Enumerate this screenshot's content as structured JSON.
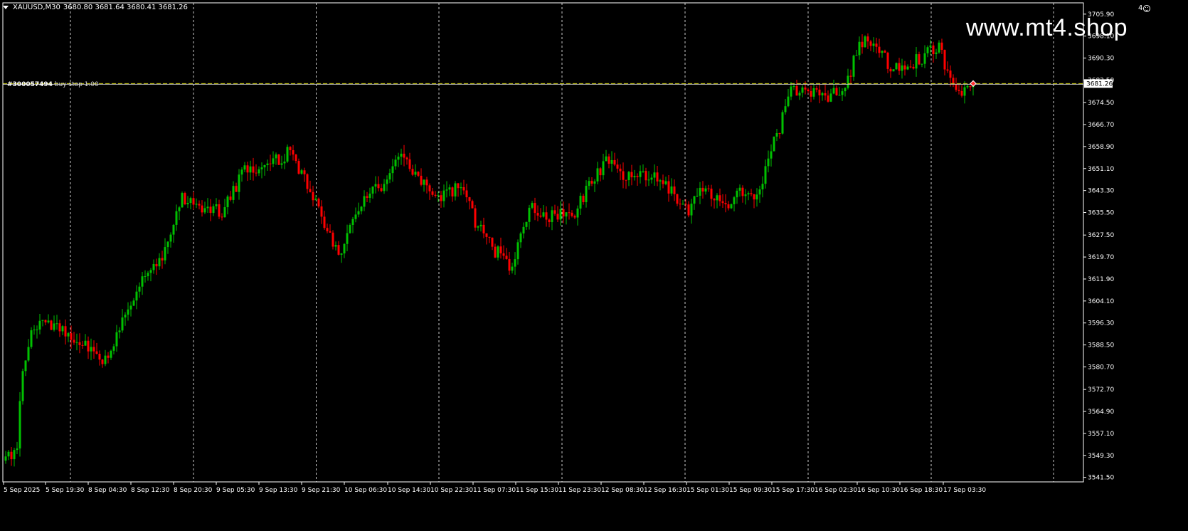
{
  "window": {
    "symbol": "XAUUSD,M30",
    "ohlc": "3680.80 3681.64 3680.41 3681.26",
    "watermark": "www.mt4.shop",
    "expert_count": "4",
    "expert_icon": "smiley-icon"
  },
  "order_line": {
    "id": "#300057494",
    "label": "buy stop 1.00"
  },
  "colors": {
    "background": "#000000",
    "bull": "#00c000",
    "bear": "#ff0000",
    "grid": "#c8c8c8",
    "order_line": "#c8c800",
    "bid_line": "#c8c8c8",
    "text": "#ffffff"
  },
  "chart_data": {
    "type": "candlestick",
    "symbol": "XAUUSD",
    "timeframe": "M30",
    "current_price": 3681.26,
    "order_price": 3681.26,
    "price_axis_ticks": [
      "3705.90",
      "3698.10",
      "3690.30",
      "3682.50",
      "3674.50",
      "3666.70",
      "3658.90",
      "3651.10",
      "3643.30",
      "3635.50",
      "3627.50",
      "3619.70",
      "3611.90",
      "3604.10",
      "3596.30",
      "3588.50",
      "3580.70",
      "3572.70",
      "3564.90",
      "3557.10",
      "3549.30",
      "3541.50"
    ],
    "price_label": "3681.26",
    "ylim": [
      3539.9,
      3709.9
    ],
    "time_axis_ticks": [
      "5 Sep 2025",
      "5 Sep 19:30",
      "8 Sep 04:30",
      "8 Sep 12:30",
      "8 Sep 20:30",
      "9 Sep 05:30",
      "9 Sep 13:30",
      "9 Sep 21:30",
      "10 Sep 06:30",
      "10 Sep 14:30",
      "10 Sep 22:30",
      "11 Sep 07:30",
      "11 Sep 15:30",
      "11 Sep 23:30",
      "12 Sep 08:30",
      "12 Sep 16:30",
      "15 Sep 01:30",
      "15 Sep 09:30",
      "15 Sep 17:30",
      "16 Sep 02:30",
      "16 Sep 10:30",
      "16 Sep 18:30",
      "17 Sep 03:30"
    ],
    "period_separator_count": 18,
    "close_anchors": [
      {
        "bar": 0,
        "close": 3547
      },
      {
        "bar": 4,
        "close": 3553
      },
      {
        "bar": 6,
        "close": 3581
      },
      {
        "bar": 9,
        "close": 3593
      },
      {
        "bar": 14,
        "close": 3597
      },
      {
        "bar": 22,
        "close": 3592
      },
      {
        "bar": 30,
        "close": 3588
      },
      {
        "bar": 36,
        "close": 3582
      },
      {
        "bar": 40,
        "close": 3595
      },
      {
        "bar": 48,
        "close": 3612
      },
      {
        "bar": 56,
        "close": 3622
      },
      {
        "bar": 62,
        "close": 3640
      },
      {
        "bar": 68,
        "close": 3637
      },
      {
        "bar": 76,
        "close": 3636
      },
      {
        "bar": 84,
        "close": 3650
      },
      {
        "bar": 92,
        "close": 3652
      },
      {
        "bar": 100,
        "close": 3657
      },
      {
        "bar": 104,
        "close": 3650
      },
      {
        "bar": 108,
        "close": 3642
      },
      {
        "bar": 112,
        "close": 3630
      },
      {
        "bar": 118,
        "close": 3621
      },
      {
        "bar": 124,
        "close": 3638
      },
      {
        "bar": 132,
        "close": 3645
      },
      {
        "bar": 140,
        "close": 3656
      },
      {
        "bar": 146,
        "close": 3646
      },
      {
        "bar": 152,
        "close": 3640
      },
      {
        "bar": 160,
        "close": 3645
      },
      {
        "bar": 166,
        "close": 3630
      },
      {
        "bar": 172,
        "close": 3622
      },
      {
        "bar": 178,
        "close": 3616
      },
      {
        "bar": 184,
        "close": 3637
      },
      {
        "bar": 192,
        "close": 3634
      },
      {
        "bar": 200,
        "close": 3635
      },
      {
        "bar": 206,
        "close": 3648
      },
      {
        "bar": 212,
        "close": 3654
      },
      {
        "bar": 218,
        "close": 3648
      },
      {
        "bar": 224,
        "close": 3650
      },
      {
        "bar": 232,
        "close": 3645
      },
      {
        "bar": 240,
        "close": 3636
      },
      {
        "bar": 246,
        "close": 3645
      },
      {
        "bar": 252,
        "close": 3637
      },
      {
        "bar": 258,
        "close": 3644
      },
      {
        "bar": 264,
        "close": 3640
      },
      {
        "bar": 268,
        "close": 3654
      },
      {
        "bar": 272,
        "close": 3666
      },
      {
        "bar": 276,
        "close": 3680
      },
      {
        "bar": 282,
        "close": 3678
      },
      {
        "bar": 290,
        "close": 3677
      },
      {
        "bar": 296,
        "close": 3682
      },
      {
        "bar": 300,
        "close": 3697
      },
      {
        "bar": 306,
        "close": 3694
      },
      {
        "bar": 312,
        "close": 3686
      },
      {
        "bar": 318,
        "close": 3688
      },
      {
        "bar": 324,
        "close": 3692
      },
      {
        "bar": 328,
        "close": 3694
      },
      {
        "bar": 334,
        "close": 3677
      },
      {
        "bar": 340,
        "close": 3681.26
      }
    ]
  }
}
